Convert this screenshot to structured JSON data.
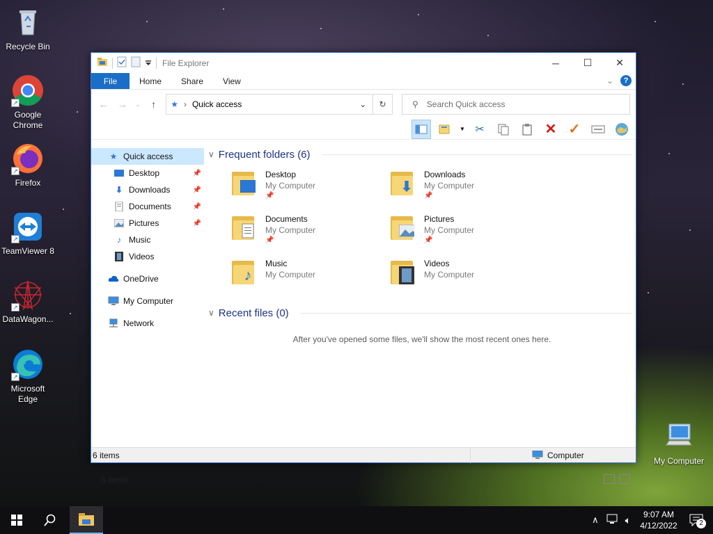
{
  "desktop": {
    "icons": [
      {
        "label": "Recycle Bin",
        "icon": "recycle-bin-icon"
      },
      {
        "label": "Google Chrome",
        "icon": "chrome-icon"
      },
      {
        "label": "Firefox",
        "icon": "firefox-icon"
      },
      {
        "label": "TeamViewer 8",
        "icon": "teamviewer-icon"
      },
      {
        "label": "DataWagon...",
        "icon": "datawagon-icon"
      },
      {
        "label": "Microsoft Edge",
        "icon": "edge-icon"
      },
      {
        "label": "My Computer",
        "icon": "computer-icon"
      }
    ]
  },
  "window": {
    "title": "File Explorer",
    "ribbon_tabs": [
      "File",
      "Home",
      "Share",
      "View"
    ],
    "address": "Quick access",
    "search_placeholder": "Search Quick access",
    "nav": {
      "quick_access": "Quick access",
      "pinned": [
        {
          "label": "Desktop",
          "pinned": true
        },
        {
          "label": "Downloads",
          "pinned": true
        },
        {
          "label": "Documents",
          "pinned": true
        },
        {
          "label": "Pictures",
          "pinned": true
        },
        {
          "label": "Music",
          "pinned": false
        },
        {
          "label": "Videos",
          "pinned": false
        }
      ],
      "onedrive": "OneDrive",
      "computer": "My Computer",
      "network": "Network"
    },
    "frequent": {
      "heading": "Frequent folders (6)",
      "folders": [
        {
          "name": "Desktop",
          "location": "My Computer",
          "pinned": true
        },
        {
          "name": "Downloads",
          "location": "My Computer",
          "pinned": true
        },
        {
          "name": "Documents",
          "location": "My Computer",
          "pinned": true
        },
        {
          "name": "Pictures",
          "location": "My Computer",
          "pinned": true
        },
        {
          "name": "Music",
          "location": "My Computer",
          "pinned": false
        },
        {
          "name": "Videos",
          "location": "My Computer",
          "pinned": false
        }
      ]
    },
    "recent": {
      "heading": "Recent files (0)",
      "empty_text": "After you've opened some files, we'll show the most recent ones here."
    },
    "status_items": "6 items",
    "status_bottom_items": "6 items",
    "status_location": "Computer"
  },
  "taskbar": {
    "time": "9:07 AM",
    "date": "4/12/2022",
    "notifications": "2"
  }
}
